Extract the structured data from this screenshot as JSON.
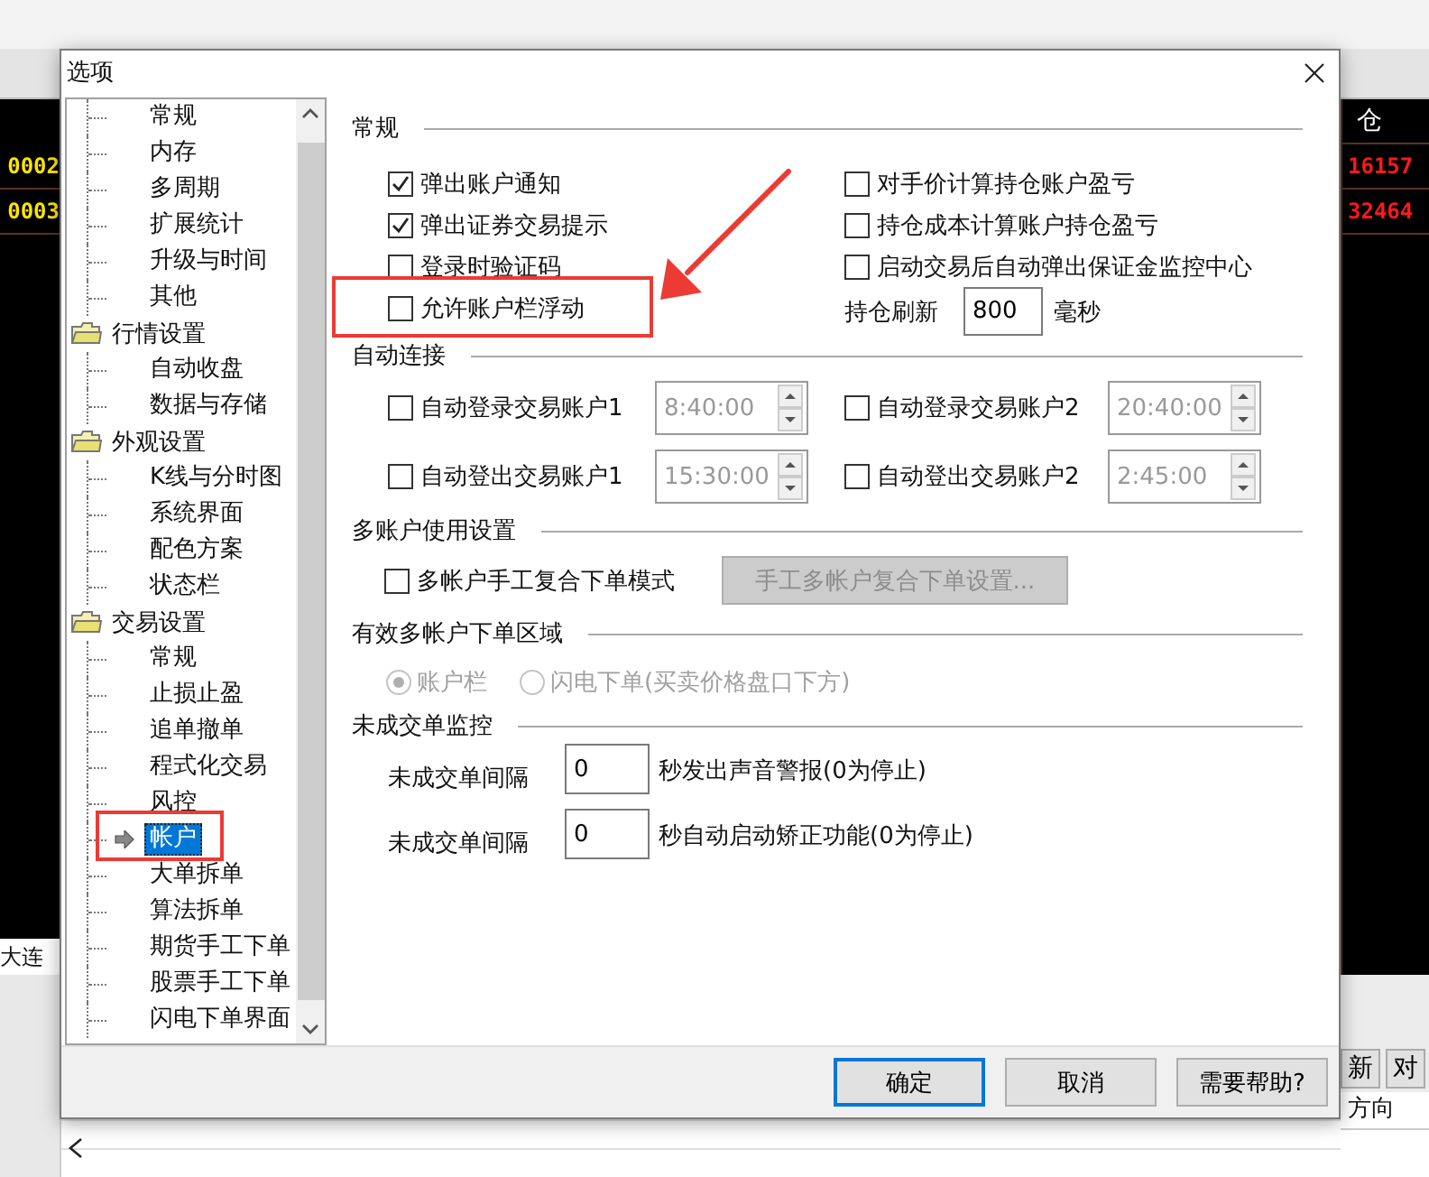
{
  "background": {
    "left_codes": [
      "0002",
      "0003"
    ],
    "left_footer": "大连",
    "right_header": "仓",
    "right_values": [
      "16157",
      "32464"
    ],
    "right_buttons": [
      "新",
      "对"
    ],
    "right_column_header": "方向"
  },
  "dialog": {
    "title": "选项"
  },
  "tree": [
    {
      "label": "常规",
      "kind": "item",
      "selected": false
    },
    {
      "label": "内存",
      "kind": "item",
      "selected": false
    },
    {
      "label": "多周期",
      "kind": "item",
      "selected": false
    },
    {
      "label": "扩展统计",
      "kind": "item",
      "selected": false
    },
    {
      "label": "升级与时间",
      "kind": "item",
      "selected": false
    },
    {
      "label": "其他",
      "kind": "item",
      "selected": false
    },
    {
      "label": "行情设置",
      "kind": "folder",
      "children": [
        {
          "label": "自动收盘",
          "kind": "item",
          "selected": false
        },
        {
          "label": "数据与存储",
          "kind": "item",
          "selected": false
        }
      ]
    },
    {
      "label": "外观设置",
      "kind": "folder",
      "children": [
        {
          "label": "K线与分时图",
          "kind": "item",
          "selected": false
        },
        {
          "label": "系统界面",
          "kind": "item",
          "selected": false
        },
        {
          "label": "配色方案",
          "kind": "item",
          "selected": false
        },
        {
          "label": "状态栏",
          "kind": "item",
          "selected": false
        }
      ]
    },
    {
      "label": "交易设置",
      "kind": "folder",
      "children": [
        {
          "label": "常规",
          "kind": "item",
          "selected": false
        },
        {
          "label": "止损止盈",
          "kind": "item",
          "selected": false
        },
        {
          "label": "追单撤单",
          "kind": "item",
          "selected": false
        },
        {
          "label": "程式化交易",
          "kind": "item",
          "selected": false
        },
        {
          "label": "风控",
          "kind": "item",
          "selected": false
        },
        {
          "label": "帐户",
          "kind": "item",
          "selected": true
        },
        {
          "label": "大单拆单",
          "kind": "item",
          "selected": false
        },
        {
          "label": "算法拆单",
          "kind": "item",
          "selected": false
        },
        {
          "label": "期货手工下单",
          "kind": "item",
          "selected": false
        },
        {
          "label": "股票手工下单",
          "kind": "item",
          "selected": false
        },
        {
          "label": "闪电下单界面",
          "kind": "item",
          "selected": false
        }
      ]
    }
  ],
  "general": {
    "title": "常规",
    "left": [
      {
        "label": "弹出账户通知",
        "checked": true
      },
      {
        "label": "弹出证券交易提示",
        "checked": true
      },
      {
        "label": "登录时验证码",
        "checked": false
      },
      {
        "label": "允许账户栏浮动",
        "checked": false
      }
    ],
    "right": [
      {
        "label": "对手价计算持仓账户盈亏",
        "checked": false
      },
      {
        "label": "持仓成本计算账户持仓盈亏",
        "checked": false
      },
      {
        "label": "启动交易后自动弹出保证金监控中心",
        "checked": false
      }
    ],
    "refresh": {
      "label": "持仓刷新",
      "value": "800",
      "unit": "毫秒"
    }
  },
  "auto_connect": {
    "title": "自动连接",
    "items": [
      {
        "label": "自动登录交易账户1",
        "checked": false,
        "value": "8:40:00",
        "disabled": true
      },
      {
        "label": "自动登录交易账户2",
        "checked": false,
        "value": "20:40:00",
        "disabled": true
      },
      {
        "label": "自动登出交易账户1",
        "checked": false,
        "value": "15:30:00",
        "disabled": true
      },
      {
        "label": "自动登出交易账户2",
        "checked": false,
        "value": "2:45:00",
        "disabled": true
      }
    ]
  },
  "multi_account": {
    "title": "多账户使用设置",
    "checkbox": {
      "label": "多帐户手工复合下单模式",
      "checked": false
    },
    "button": {
      "label": "手工多帐户复合下单设置...",
      "disabled": true
    }
  },
  "order_area": {
    "title": "有效多帐户下单区域",
    "radios": [
      {
        "label": "账户栏",
        "selected": true,
        "disabled": true
      },
      {
        "label": "闪电下单(买卖价格盘口下方)",
        "selected": false,
        "disabled": true
      }
    ]
  },
  "monitor": {
    "title": "未成交单监控",
    "rows": [
      {
        "label": "未成交单间隔",
        "value": "0",
        "suffix": "秒发出声音警报(0为停止)"
      },
      {
        "label": "未成交单间隔",
        "value": "0",
        "suffix": "秒自动启动矫正功能(0为停止)"
      }
    ]
  },
  "buttons": [
    {
      "label": "确定",
      "default": true
    },
    {
      "label": "取消",
      "default": false
    },
    {
      "label": "需要帮助?",
      "default": false
    }
  ]
}
